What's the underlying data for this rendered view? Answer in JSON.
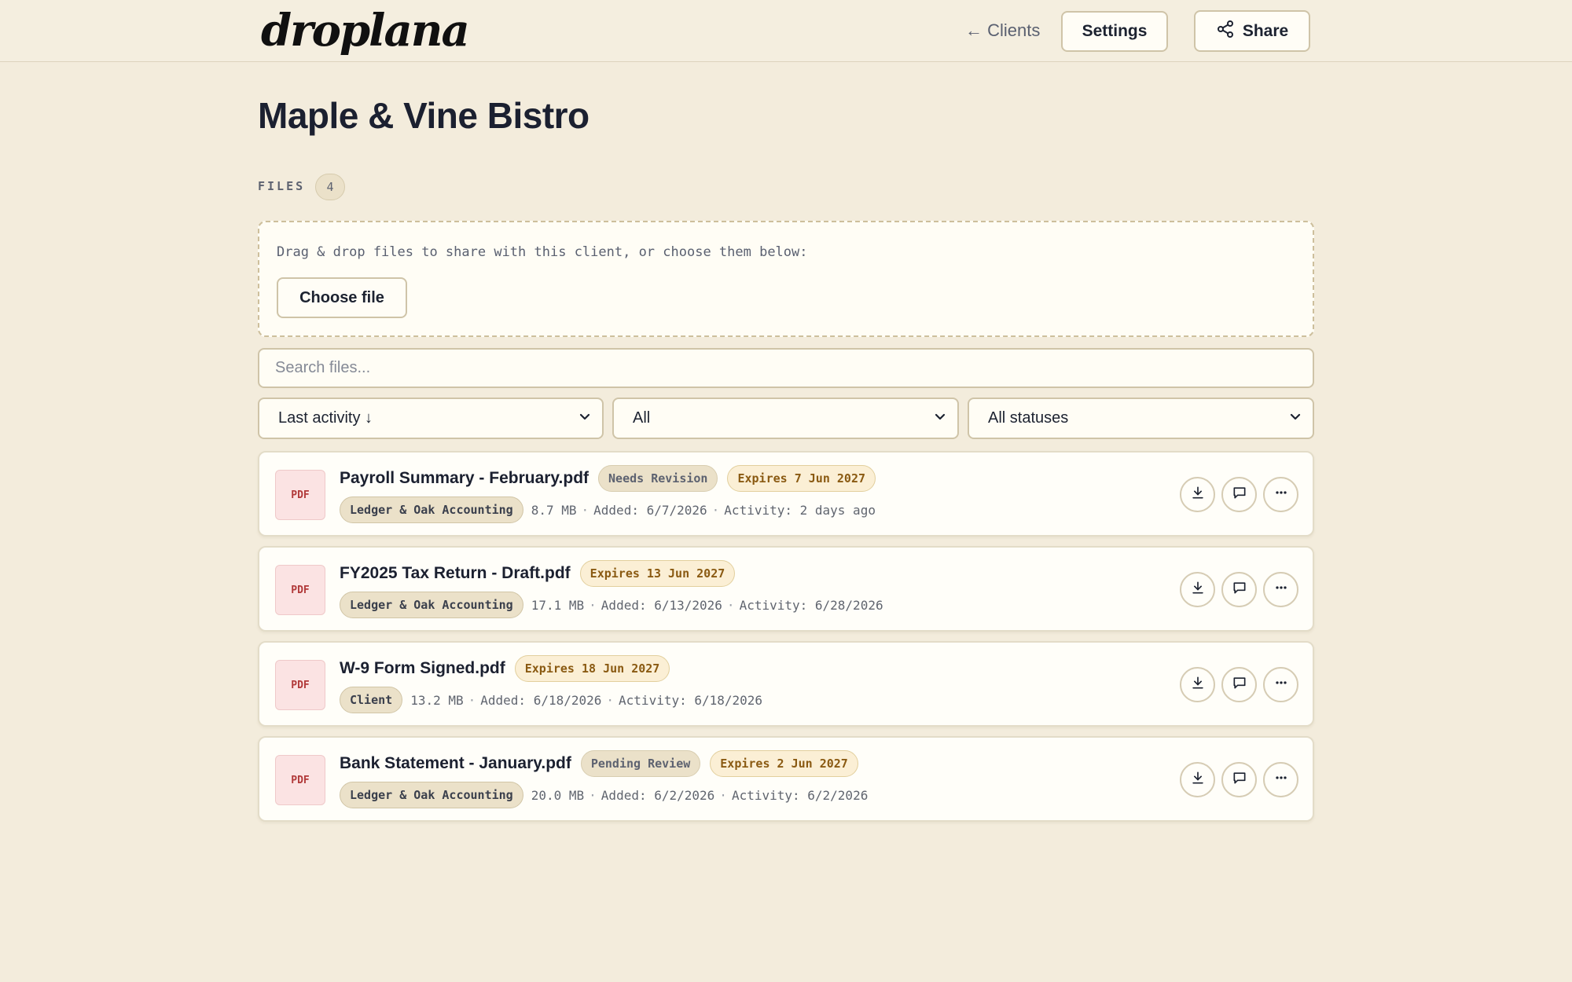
{
  "app": {
    "logo": "droplana"
  },
  "header": {
    "back_label": "← Clients",
    "settings_label": "Settings",
    "share_label": "Share"
  },
  "client": {
    "name": "Maple & Vine Bistro"
  },
  "files_section": {
    "label": "FILES",
    "count": "4"
  },
  "dropzone": {
    "text": "Drag & drop files to share with this client, or choose them below:",
    "choose_label": "Choose file"
  },
  "search": {
    "placeholder": "Search files..."
  },
  "filters": {
    "sort": "Last activity ↓",
    "type": "All",
    "status": "All statuses"
  },
  "file_icon_label": "PDF",
  "files": [
    {
      "name": "Payroll Summary - February.pdf",
      "status": "Needs Revision",
      "expiry": "Expires 7 Jun 2027",
      "owner": "Ledger & Oak Accounting",
      "size": "8.7 MB",
      "added": "Added: 6/7/2026",
      "activity": "Activity: 2 days ago"
    },
    {
      "name": "FY2025 Tax Return - Draft.pdf",
      "status": "",
      "expiry": "Expires 13 Jun 2027",
      "owner": "Ledger & Oak Accounting",
      "size": "17.1 MB",
      "added": "Added: 6/13/2026",
      "activity": "Activity: 6/28/2026"
    },
    {
      "name": "W-9 Form Signed.pdf",
      "status": "",
      "expiry": "Expires 18 Jun 2027",
      "owner": "Client",
      "size": "13.2 MB",
      "added": "Added: 6/18/2026",
      "activity": "Activity: 6/18/2026"
    },
    {
      "name": "Bank Statement - January.pdf",
      "status": "Pending Review",
      "expiry": "Expires 2 Jun 2027",
      "owner": "Ledger & Oak Accounting",
      "size": "20.0 MB",
      "added": "Added: 6/2/2026",
      "activity": "Activity: 6/2/2026"
    }
  ],
  "icons": {
    "back": "arrow-left-icon",
    "share": "share-icon",
    "download": "download-icon",
    "comment": "comment-icon",
    "more": "more-icon",
    "dropdown": "chevron-down-icon"
  }
}
